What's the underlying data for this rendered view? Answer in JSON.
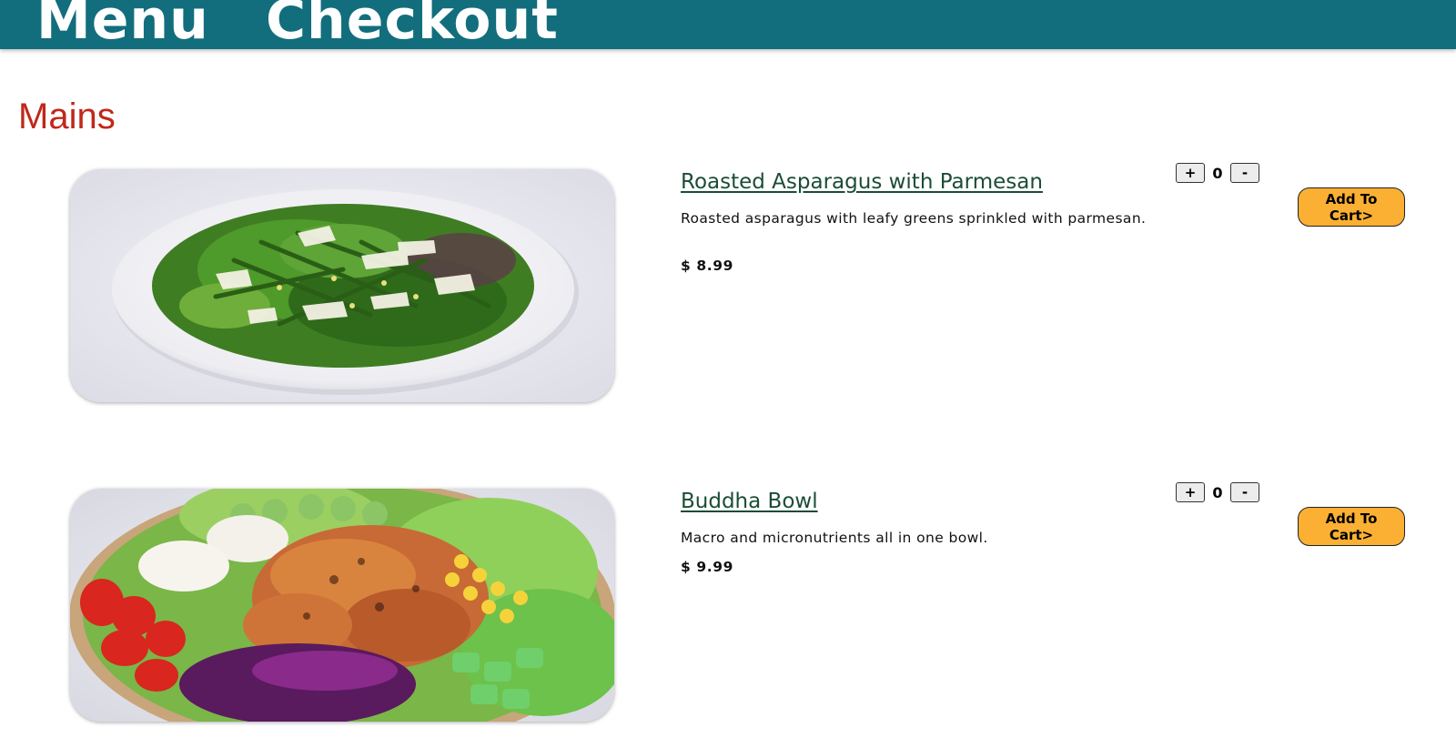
{
  "nav": {
    "menu_label": "Menu",
    "checkout_label": "Checkout"
  },
  "section": {
    "title": "Mains"
  },
  "items": [
    {
      "name": "Roasted Asparagus with Parmesan",
      "description": "Roasted asparagus with leafy greens sprinkled with parmesan.",
      "price": "$ 8.99",
      "quantity": "0",
      "plus_label": "+",
      "minus_label": "-",
      "add_label": "Add To Cart>"
    },
    {
      "name": "Buddha Bowl",
      "description": "Macro and micronutrients all in one bowl.",
      "price": "$ 9.99",
      "quantity": "0",
      "plus_label": "+",
      "minus_label": "-",
      "add_label": "Add To Cart>"
    }
  ],
  "colors": {
    "header_bg": "#126e7c",
    "section_title": "#c0281a",
    "item_name": "#1b4d36",
    "add_button": "#fbb033"
  }
}
